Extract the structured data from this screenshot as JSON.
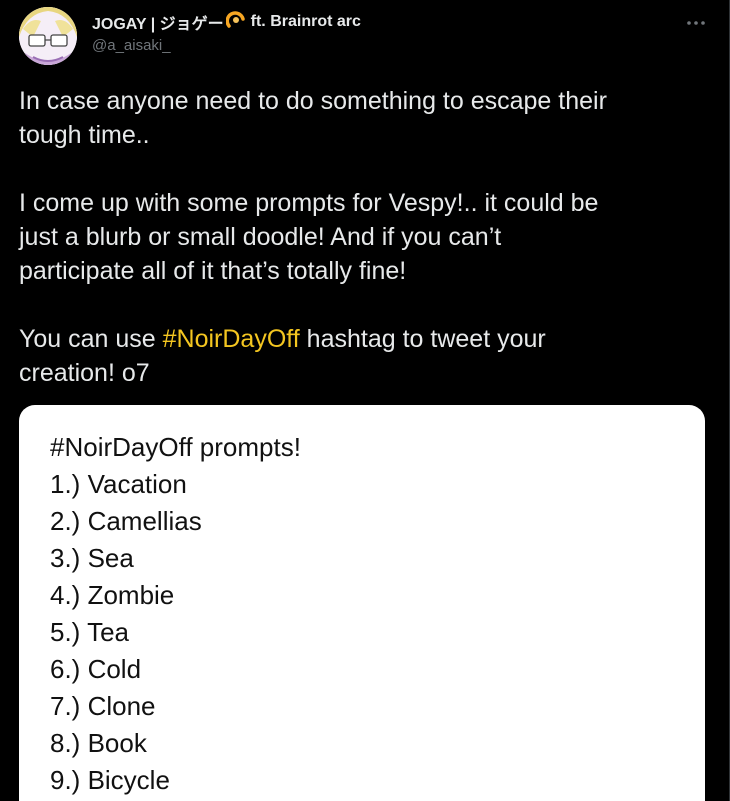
{
  "author": {
    "display_name": "JOGAY | ジョゲー",
    "display_name_suffix": "ft. Brainrot arc",
    "handle": "@a_aisaki_"
  },
  "menu": {
    "icon": "more-horizontal-icon"
  },
  "tweet": {
    "line1a": "In case anyone need to do something to escape their",
    "line1b": "tough time..",
    "line2a": "I come up with some prompts for Vespy!.. it could be",
    "line2b": "just a blurb or small doodle! And if you can’t",
    "line2c": "participate all of it that’s totally fine!",
    "line3a_pre": "You can use ",
    "hashtag": "#NoirDayOff",
    "line3a_post": " hashtag to tweet your",
    "line3b": "creation! o7"
  },
  "image_card": {
    "title": "#NoirDayOff prompts!",
    "items": [
      "1.) Vacation",
      "2.) Camellias",
      "3.) Sea",
      "4.) Zombie",
      "5.) Tea",
      "6.) Cold",
      "7.) Clone",
      "8.) Book",
      "9.) Bicycle"
    ]
  },
  "colors": {
    "background": "#000000",
    "text": "#e7e9ea",
    "muted": "#71767b",
    "hashtag": "#f4c620",
    "card_bg": "#ffffff"
  }
}
